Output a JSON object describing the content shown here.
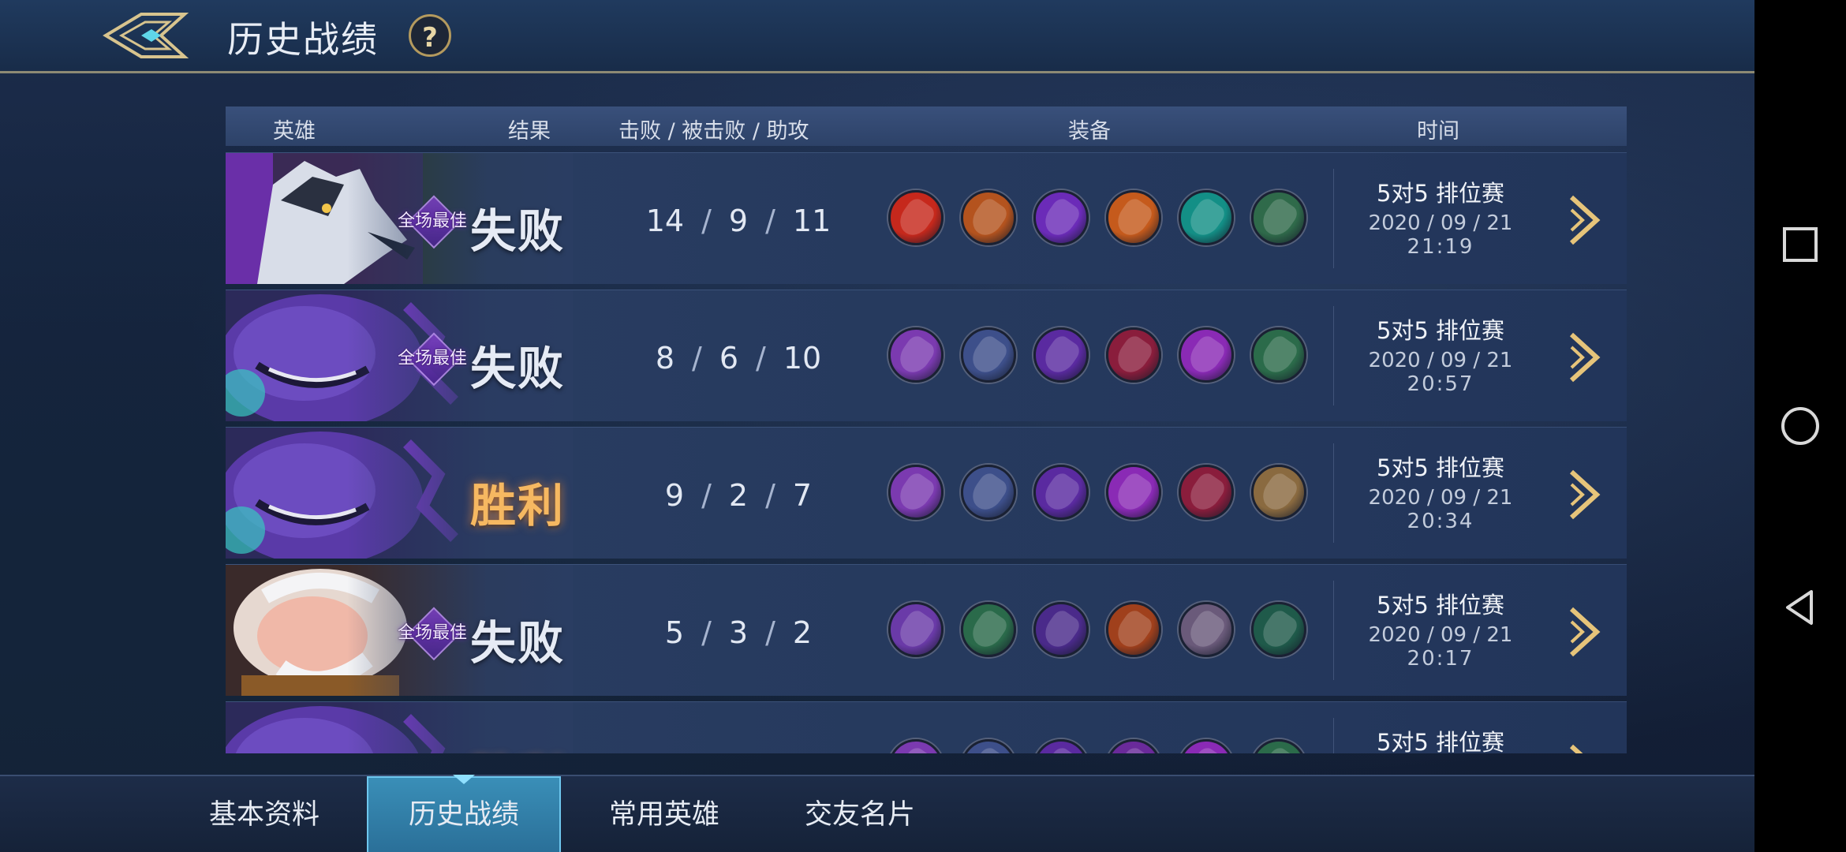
{
  "header": {
    "title": "历史战绩",
    "help_label": "?"
  },
  "table": {
    "columns": {
      "hero": "英雄",
      "result": "结果",
      "kda": "击败 / 被击败 / 助攻",
      "items": "装备",
      "time": "时间"
    }
  },
  "matches": [
    {
      "hero_icon": "wolf-hero-portrait",
      "mvp": "全场最佳",
      "result": "失败",
      "kills": "14",
      "deaths": "9",
      "assists": "11",
      "mode": "5对5 排位赛",
      "date": "2020 / 09 / 21",
      "time": "21:19",
      "items": [
        "#c6281c",
        "#b4531e",
        "#6b2bb8",
        "#c55a1c",
        "#138f86",
        "#2f6a4a"
      ]
    },
    {
      "hero_icon": "purple-creature-hero-portrait",
      "mvp": "全场最佳",
      "result": "失败",
      "kills": "8",
      "deaths": "6",
      "assists": "10",
      "mode": "5对5 排位赛",
      "date": "2020 / 09 / 21",
      "time": "20:57",
      "items": [
        "#7b3ab0",
        "#3d4f8a",
        "#5a2aa0",
        "#8a1d3c",
        "#8a2ab5",
        "#2b6b4a"
      ]
    },
    {
      "hero_icon": "purple-creature-hero-portrait",
      "mvp": "",
      "result": "胜利",
      "kills": "9",
      "deaths": "2",
      "assists": "7",
      "mode": "5对5 排位赛",
      "date": "2020 / 09 / 21",
      "time": "20:34",
      "items": [
        "#7b3ab0",
        "#3d4f8a",
        "#5a2aa0",
        "#8a2ab5",
        "#8a1d3c",
        "#8a6a40"
      ]
    },
    {
      "hero_icon": "old-sage-hero-portrait",
      "mvp": "全场最佳",
      "result": "失败",
      "kills": "5",
      "deaths": "3",
      "assists": "2",
      "mode": "5对5 排位赛",
      "date": "2020 / 09 / 21",
      "time": "20:17",
      "items": [
        "#6a3aa8",
        "#2a6a4a",
        "#4a2a8a",
        "#a0401c",
        "#6a5a7a",
        "#1f5a4a"
      ]
    },
    {
      "hero_icon": "purple-creature-hero-portrait",
      "mvp": "",
      "result": "胜利",
      "kills": "",
      "deaths": "",
      "assists": "",
      "mode": "5对5 排位赛",
      "date": "",
      "time": "",
      "items": [
        "#7b3ab0",
        "#3d4f8a",
        "#5a2aa0",
        "#6a2a9a",
        "#8a2ab5",
        "#2b6b4a"
      ]
    }
  ],
  "tabs": [
    {
      "label": "基本资料",
      "active": false
    },
    {
      "label": "历史战绩",
      "active": true
    },
    {
      "label": "常用英雄",
      "active": false
    },
    {
      "label": "交友名片",
      "active": false
    }
  ],
  "system_nav": [
    "square-icon",
    "circle-icon",
    "triangle-back-icon"
  ]
}
